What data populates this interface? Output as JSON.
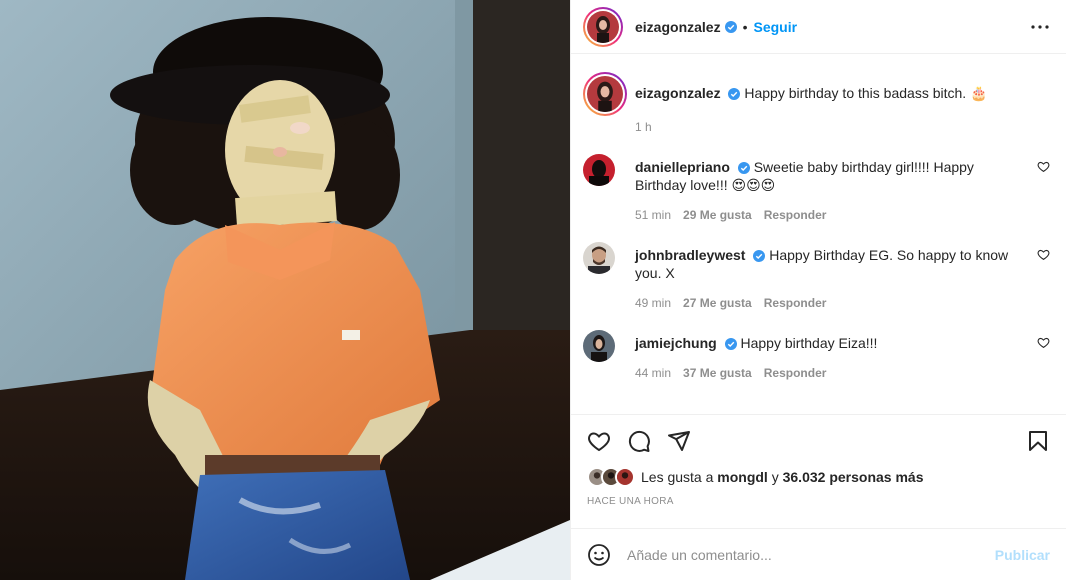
{
  "header": {
    "username": "eizagonzalez",
    "separator": "•",
    "follow_label": "Seguir"
  },
  "caption": {
    "username": "eizagonzalez",
    "text": "Happy birthday to this badass bitch. 🎂",
    "time": "1 h"
  },
  "comments": [
    {
      "username": "daniellepriano",
      "text": "Sweetie baby birthday girl!!!! Happy Birthday love!!! 😍😍😍",
      "time": "51 min",
      "likes": "29 Me gusta",
      "reply": "Responder"
    },
    {
      "username": "johnbradleywest",
      "text": "Happy Birthday EG. So happy to know you. X",
      "time": "49 min",
      "likes": "27 Me gusta",
      "reply": "Responder"
    },
    {
      "username": "jamiejchung",
      "text": "Happy birthday Eiza!!!",
      "time": "44 min",
      "likes": "37 Me gusta",
      "reply": "Responder"
    }
  ],
  "likes": {
    "prefix": "Les gusta a",
    "user": "mongdl",
    "conj": "y",
    "others": "36.032 personas más"
  },
  "posted_ago": "HACE UNA HORA",
  "add_comment": {
    "placeholder": "Añade un comentario...",
    "publish_label": "Publicar"
  },
  "colors": {
    "link": "#0095f6",
    "verified": "#3897f0",
    "muted": "#8e8e8e",
    "publish_disabled": "#b2dffc"
  },
  "icons": [
    "more-options-icon",
    "heart-icon",
    "comment-icon",
    "share-icon",
    "bookmark-icon",
    "emoji-icon",
    "verified-badge-icon"
  ]
}
